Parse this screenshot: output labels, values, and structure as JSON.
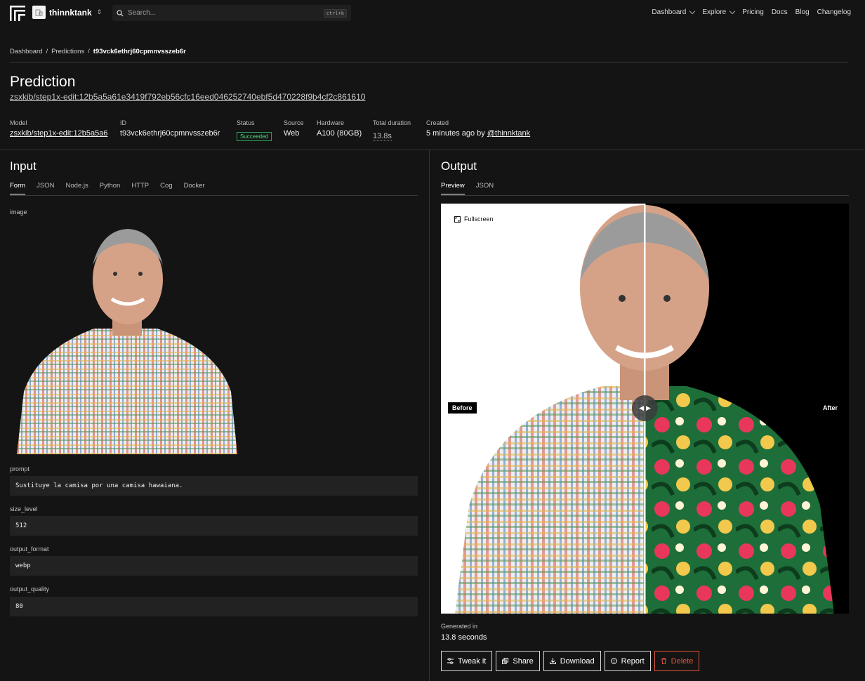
{
  "brand": {
    "org_name": "thinnktank"
  },
  "search": {
    "placeholder": "Search...",
    "shortcut": "ctrl+k"
  },
  "nav": {
    "dashboard": "Dashboard",
    "explore": "Explore",
    "pricing": "Pricing",
    "docs": "Docs",
    "blog": "Blog",
    "changelog": "Changelog"
  },
  "breadcrumb": {
    "dashboard": "Dashboard",
    "predictions": "Predictions",
    "current": "t93vck6ethrj60cpmnvsszeb6r",
    "sep": "/"
  },
  "prediction": {
    "title": "Prediction",
    "model_version": "zsxkib/step1x-edit:12b5a5a61e3419f792eb56cfc16eed046252740ebf5d470228f9b4cf2c861610"
  },
  "meta": {
    "model_label": "Model",
    "model_value": "zsxkib/step1x-edit:12b5a5a6",
    "id_label": "ID",
    "id_value": "t93vck6ethrj60cpmnvsszeb6r",
    "status_label": "Status",
    "status_value": "Succeeded",
    "source_label": "Source",
    "source_value": "Web",
    "hardware_label": "Hardware",
    "hardware_value": "A100 (80GB)",
    "duration_label": "Total duration",
    "duration_value": "13.8s",
    "created_label": "Created",
    "created_value": "5 minutes ago",
    "created_by": "by",
    "created_user": "@thinnktank"
  },
  "input": {
    "title": "Input",
    "tabs": [
      "Form",
      "JSON",
      "Node.js",
      "Python",
      "HTTP",
      "Cog",
      "Docker"
    ],
    "image_label": "image",
    "prompt_label": "prompt",
    "prompt_value": "Sustituye la camisa por una camisa hawaiana.",
    "size_label": "size_level",
    "size_value": "512",
    "format_label": "output_format",
    "format_value": "webp",
    "quality_label": "output_quality",
    "quality_value": "80"
  },
  "output": {
    "title": "Output",
    "tabs": [
      "Preview",
      "JSON"
    ],
    "fullscreen": "Fullscreen",
    "before": "Before",
    "after": "After",
    "generated_label": "Generated in",
    "generated_value": "13.8 seconds",
    "actions": {
      "tweak": "Tweak it",
      "share": "Share",
      "download": "Download",
      "report": "Report",
      "delete": "Delete"
    }
  },
  "colors": {
    "background": "#141414",
    "success": "#4ade80",
    "danger": "#e0533a"
  },
  "icons": [
    "logo-icon",
    "org-avatar-icon",
    "search-icon",
    "fullscreen-icon",
    "compare-handle-icon",
    "tweak-icon",
    "share-icon",
    "download-icon",
    "report-icon",
    "delete-icon"
  ]
}
